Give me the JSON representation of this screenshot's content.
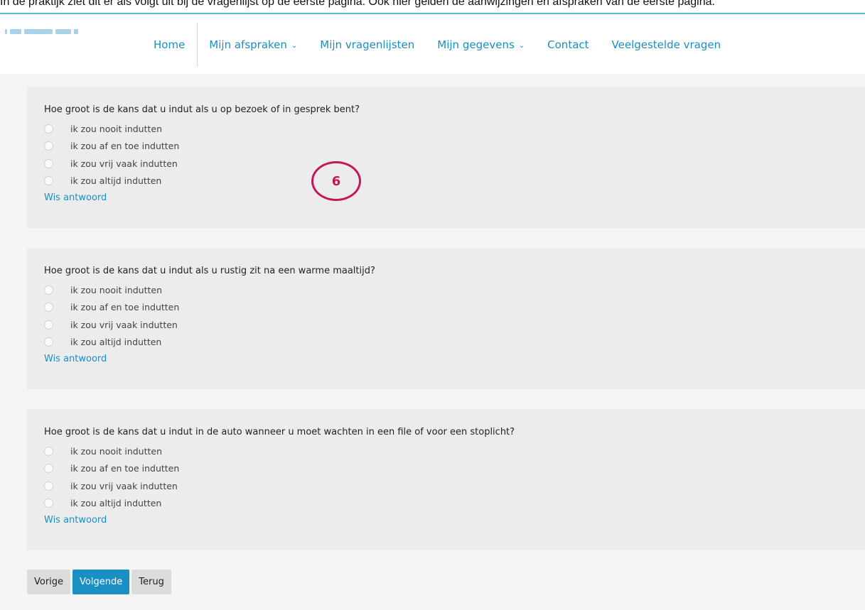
{
  "intro_text": "In de praktijk ziet dit er als volgt uit bij de vragenlijst op de eerste pagina. Ook hier gelden de aanwijzingen en afspraken van de eerste pagina.",
  "nav": {
    "home": "Home",
    "afspraken": "Mijn afspraken",
    "vragenlijsten": "Mijn vragenlijsten",
    "gegevens": "Mijn gegevens",
    "contact": "Contact",
    "faq": "Veelgestelde vragen"
  },
  "questions": [
    {
      "text": "Hoe groot is de kans dat u indut als u op bezoek of in gesprek bent?",
      "options": [
        "ik zou nooit indutten",
        "ik zou af en toe indutten",
        "ik zou vrij vaak indutten",
        "ik zou altijd indutten"
      ],
      "clear_label": "Wis antwoord"
    },
    {
      "text": "Hoe groot is de kans dat u indut als u rustig zit na een warme maaltijd?",
      "options": [
        "ik zou nooit indutten",
        "ik zou af en toe indutten",
        "ik zou vrij vaak indutten",
        "ik zou altijd indutten"
      ],
      "clear_label": "Wis antwoord"
    },
    {
      "text": "Hoe groot is de kans dat u indut in de auto wanneer u moet wachten in een file of voor een stoplicht?",
      "options": [
        "ik zou nooit indutten",
        "ik zou af en toe indutten",
        "ik zou vrij vaak indutten",
        "ik zou altijd indutten"
      ],
      "clear_label": "Wis antwoord"
    }
  ],
  "marker_number": "6",
  "buttons": {
    "previous": "Vorige",
    "next": "Volgende",
    "back": "Terug"
  },
  "colors": {
    "accent": "#1a8fc4",
    "marker": "#c2185b",
    "header_border": "#5fb8d6"
  }
}
